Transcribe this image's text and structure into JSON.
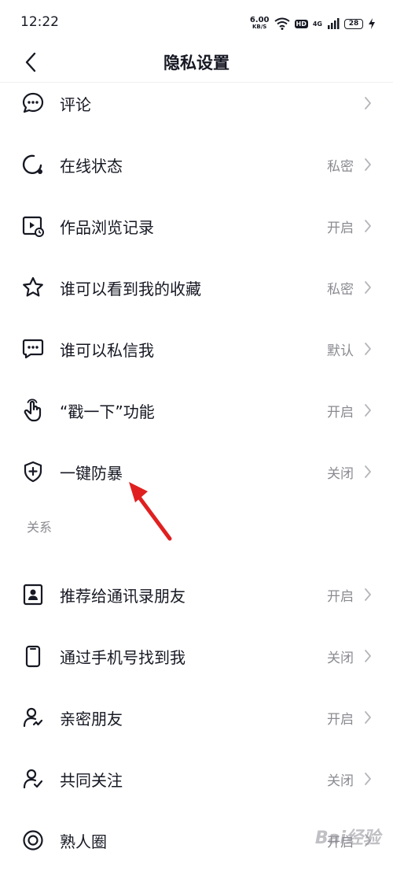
{
  "status_bar": {
    "time": "12:22",
    "net_speed": "6.00",
    "net_speed_unit": "KB/S",
    "hd": "HD",
    "network": "4G",
    "battery": "28"
  },
  "header": {
    "title": "隐私设置",
    "back_icon": "chevron-left-icon"
  },
  "colors": {
    "text": "#161823",
    "secondary": "#8a8b91",
    "divider": "#f0f0f2",
    "arrow": "#e02020"
  },
  "items": [
    {
      "label": "评论",
      "value": "",
      "icon": "comment-bubble-icon"
    },
    {
      "label": "在线状态",
      "value": "私密",
      "icon": "online-status-icon"
    },
    {
      "label": "作品浏览记录",
      "value": "开启",
      "icon": "video-history-icon"
    },
    {
      "label": "谁可以看到我的收藏",
      "value": "私密",
      "icon": "star-icon"
    },
    {
      "label": "谁可以私信我",
      "value": "默认",
      "icon": "message-icon"
    },
    {
      "label": "“戳一下”功能",
      "value": "开启",
      "icon": "tap-hand-icon"
    },
    {
      "label": "一键防暴",
      "value": "关闭",
      "icon": "shield-plus-icon"
    }
  ],
  "section_relations": {
    "title": "关系",
    "items": [
      {
        "label": "推荐给通讯录朋友",
        "value": "开启",
        "icon": "contact-card-icon"
      },
      {
        "label": "通过手机号找到我",
        "value": "关闭",
        "icon": "phone-icon"
      },
      {
        "label": "亲密朋友",
        "value": "开启",
        "icon": "close-friend-icon"
      },
      {
        "label": "共同关注",
        "value": "关闭",
        "icon": "mutual-follow-icon"
      },
      {
        "label": "熟人圈",
        "value": "开启",
        "icon": "acquaintance-circle-icon"
      }
    ]
  },
  "watermark": "Bai经验"
}
